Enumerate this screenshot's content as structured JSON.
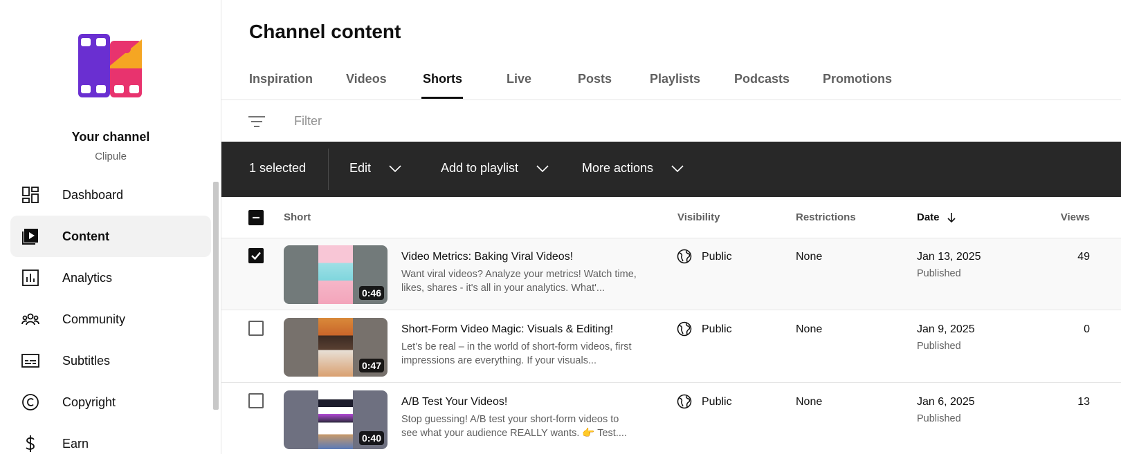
{
  "sidebar": {
    "channel_name": "Your channel",
    "channel_handle": "Clipule",
    "items": [
      {
        "label": "Dashboard",
        "icon": "dashboard-icon"
      },
      {
        "label": "Content",
        "icon": "content-icon",
        "active": true
      },
      {
        "label": "Analytics",
        "icon": "analytics-icon"
      },
      {
        "label": "Community",
        "icon": "community-icon"
      },
      {
        "label": "Subtitles",
        "icon": "subtitles-icon"
      },
      {
        "label": "Copyright",
        "icon": "copyright-icon"
      },
      {
        "label": "Earn",
        "icon": "earn-icon"
      }
    ]
  },
  "page": {
    "title": "Channel content"
  },
  "tabs": [
    {
      "label": "Inspiration"
    },
    {
      "label": "Videos"
    },
    {
      "label": "Shorts",
      "active": true
    },
    {
      "label": "Live"
    },
    {
      "label": "Posts"
    },
    {
      "label": "Playlists"
    },
    {
      "label": "Podcasts"
    },
    {
      "label": "Promotions"
    }
  ],
  "filter": {
    "placeholder": "Filter"
  },
  "action_bar": {
    "selected_count": "1 selected",
    "edit_label": "Edit",
    "playlist_label": "Add to playlist",
    "more_label": "More actions"
  },
  "table": {
    "headers": {
      "short": "Short",
      "visibility": "Visibility",
      "restrictions": "Restrictions",
      "date": "Date",
      "views": "Views"
    },
    "rows": [
      {
        "selected": true,
        "duration": "0:46",
        "title": "Video Metrics: Baking Viral Videos!",
        "description": "Want viral videos? Analyze your metrics! Watch time, likes, shares - it's all in your analytics. What'...",
        "visibility": "Public",
        "restrictions": "None",
        "date": "Jan 13, 2025",
        "status": "Published",
        "views": "49"
      },
      {
        "selected": false,
        "duration": "0:47",
        "title": "Short-Form Video Magic: Visuals & Editing!",
        "description": "Let’s be real – in the world of short-form videos, first impressions are everything. If your visuals...",
        "visibility": "Public",
        "restrictions": "None",
        "date": "Jan 9, 2025",
        "status": "Published",
        "views": "0"
      },
      {
        "selected": false,
        "duration": "0:40",
        "title": "A/B Test Your Videos!",
        "description": "Stop guessing! A/B test your short-form videos to see what your audience REALLY wants. 👉 Test....",
        "visibility": "Public",
        "restrictions": "None",
        "date": "Jan 6, 2025",
        "status": "Published",
        "views": "13"
      }
    ]
  },
  "colors": {
    "action_bar_bg": "#282828",
    "logo_purple": "#6a2fd1",
    "logo_pink": "#e8336e",
    "logo_orange": "#f5a623"
  }
}
